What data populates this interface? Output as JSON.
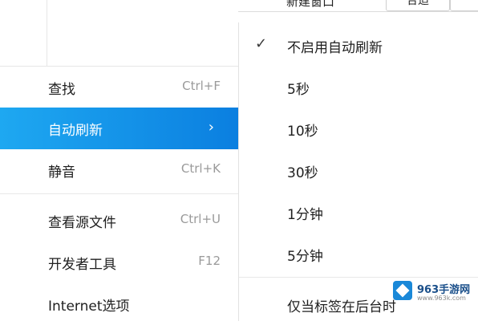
{
  "top_bar": {
    "new_window_label": "新建窗口",
    "button_1": "合适",
    "button_2": ""
  },
  "context_menu": {
    "items": [
      {
        "label": "查找",
        "shortcut": "Ctrl+F"
      },
      {
        "label": "自动刷新",
        "shortcut": "",
        "submenu_arrow": "›"
      },
      {
        "label": "静音",
        "shortcut": "Ctrl+K"
      },
      {
        "label": "查看源文件",
        "shortcut": "Ctrl+U"
      },
      {
        "label": "开发者工具",
        "shortcut": "F12"
      },
      {
        "label": "Internet选项",
        "shortcut": ""
      }
    ]
  },
  "submenu": {
    "checkmark": "✓",
    "items": [
      {
        "label": "不启用自动刷新",
        "checked": true
      },
      {
        "label": "5秒",
        "checked": false
      },
      {
        "label": "10秒",
        "checked": false
      },
      {
        "label": "30秒",
        "checked": false
      },
      {
        "label": "1分钟",
        "checked": false
      },
      {
        "label": "5分钟",
        "checked": false
      },
      {
        "label": "仅当标签在后台时",
        "checked": false
      }
    ]
  },
  "watermark": {
    "brand": "963手游网",
    "url": "www.963k.com"
  },
  "colors": {
    "accent_start": "#1ea8f1",
    "accent_end": "#0b7fe0",
    "shortcut_text": "#9a9a9a"
  }
}
